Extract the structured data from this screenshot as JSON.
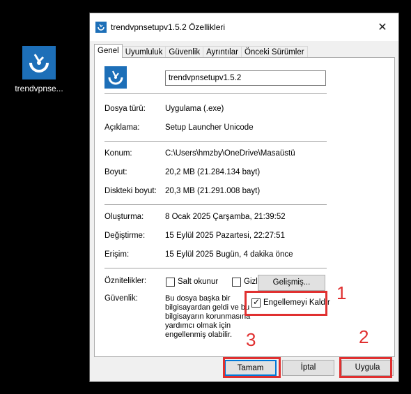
{
  "desktop": {
    "icon_label": "trendvpnse..."
  },
  "window": {
    "title": "trendvpnsetupv1.5.2 Özellikleri",
    "close_symbol": "✕",
    "tabs": [
      "Genel",
      "Uyumluluk",
      "Güvenlik",
      "Ayrıntılar",
      "Önceki Sürümler"
    ]
  },
  "general": {
    "filename": "trendvpnsetupv1.5.2",
    "file_type": {
      "label": "Dosya türü:",
      "value": "Uygulama (.exe)"
    },
    "description": {
      "label": "Açıklama:",
      "value": "Setup Launcher Unicode"
    },
    "location": {
      "label": "Konum:",
      "value": "C:\\Users\\hmzby\\OneDrive\\Masaüstü"
    },
    "size": {
      "label": "Boyut:",
      "value": "20,2 MB (21.284.134 bayt)"
    },
    "disk_size": {
      "label": "Diskteki boyut:",
      "value": "20,3 MB (21.291.008 bayt)"
    },
    "created": {
      "label": "Oluşturma:",
      "value": "8 Ocak 2025 Çarşamba, 21:39:52"
    },
    "modified": {
      "label": "Değiştirme:",
      "value": "15 Eylül 2025 Pazartesi, 22:27:51"
    },
    "accessed": {
      "label": "Erişim:",
      "value": "15 Eylül 2025 Bugün, 4 dakika önce"
    },
    "attributes": {
      "label": "Öznitelikler:",
      "readonly_label": "Salt okunur",
      "hidden_label": "Gizli",
      "advanced_button": "Gelişmiş..."
    },
    "security": {
      "label": "Güvenlik:",
      "text": "Bu dosya başka bir bilgisayardan geldi ve bu bilgisayarın korunmasına yardımcı olmak için engellenmiş olabilir.",
      "unblock_label": "Engellemeyi Kaldır",
      "unblock_checked": true
    }
  },
  "buttons": {
    "ok": "Tamam",
    "cancel": "İptal",
    "apply": "Uygula"
  },
  "annotations": {
    "n1": "1",
    "n2": "2",
    "n3": "3",
    "color": "#e03030"
  }
}
